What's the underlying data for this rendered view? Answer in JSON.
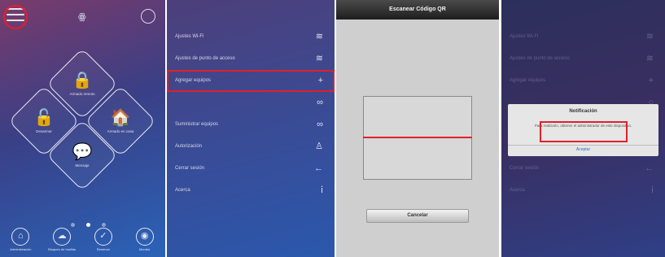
{
  "panel1": {
    "logo_glyph": "ꙮ",
    "modes": [
      {
        "label": "Armado remoto",
        "icon": "🔒"
      },
      {
        "label": "Desarmar",
        "icon": "🔓"
      },
      {
        "label": "Armado en casa",
        "icon": "🏠"
      },
      {
        "label": "Mensaje",
        "icon": "💬"
      }
    ],
    "nav": [
      {
        "label": "Administración",
        "icon": "⌂"
      },
      {
        "label": "Bloqueo de huellas",
        "icon": "☁"
      },
      {
        "label": "Reservar",
        "icon": "✓"
      },
      {
        "label": "Monitor",
        "icon": "◉"
      }
    ]
  },
  "panel2": {
    "items": [
      {
        "label": "Ajustes Wi-Fi",
        "icon": "wifi-icon",
        "glyph": "≋"
      },
      {
        "label": "Ajustes de punto de acceso",
        "icon": "wifi-icon",
        "glyph": "≋"
      },
      {
        "label": "Agregar equipos",
        "icon": "plus-icon",
        "glyph": "+"
      },
      {
        "label": "",
        "icon": "link-icon",
        "glyph": "∞"
      },
      {
        "label": "Suministrar equipos",
        "icon": "chain-icon",
        "glyph": "∞"
      },
      {
        "label": "Autorización",
        "icon": "user-icon",
        "glyph": "♙"
      },
      {
        "label": "Cerrar sesión",
        "icon": "arrow-left-icon",
        "glyph": "←"
      },
      {
        "label": "Acerca",
        "icon": "info-icon",
        "glyph": "ⅰ"
      }
    ]
  },
  "panel3": {
    "title": "Escanear Código QR",
    "cancel_label": "Cancelar"
  },
  "panel4": {
    "items": [
      {
        "label": "Ajustes Wi-Fi",
        "glyph": "≋"
      },
      {
        "label": "Ajustes de punto de acceso",
        "glyph": "≋"
      },
      {
        "label": "Agregar equipos",
        "glyph": "+"
      },
      {
        "label": "",
        "glyph": "○"
      },
      {
        "label": "",
        "glyph": ""
      },
      {
        "label": "",
        "glyph": ""
      },
      {
        "label": "Cerrar sesión",
        "glyph": "←"
      },
      {
        "label": "Acerca",
        "glyph": "ⅰ"
      }
    ],
    "dialog": {
      "title": "Notificación",
      "message": "Para realizarlo, obtener el administrador de este dispositivo.",
      "ok_label": "Aceptar"
    }
  },
  "colors": {
    "highlight": "#e0202a",
    "link": "#2b6fc4"
  }
}
